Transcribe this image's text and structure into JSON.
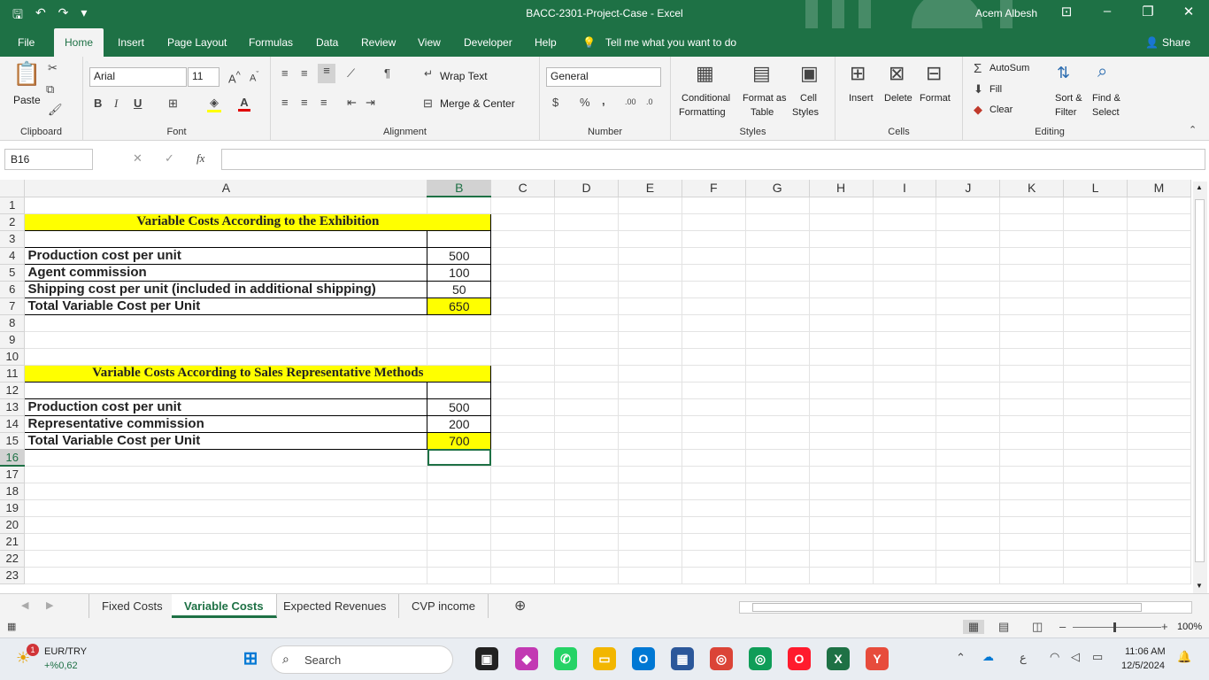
{
  "title": {
    "document": "BACC-2301-Project-Case  -  Excel",
    "user": "Acem Albesh"
  },
  "menu": {
    "tabs": [
      "File",
      "Home",
      "Insert",
      "Page Layout",
      "Formulas",
      "Data",
      "Review",
      "View",
      "Developer",
      "Help"
    ],
    "tellme": "Tell me what you want to do",
    "share": "Share"
  },
  "ribbon": {
    "clipboard": {
      "paste": "Paste",
      "label": "Clipboard"
    },
    "font": {
      "name": "Arial",
      "size": "11",
      "bold": "B",
      "italic": "I",
      "underline": "U",
      "label": "Font"
    },
    "alignment": {
      "wrap": "Wrap Text",
      "merge": "Merge & Center",
      "label": "Alignment"
    },
    "number": {
      "format": "General",
      "currency": "$",
      "percent": "%",
      "comma": ",",
      "label": "Number"
    },
    "styles": {
      "conditional1": "Conditional",
      "conditional2": "Formatting",
      "formatas1": "Format as",
      "formatas2": "Table",
      "cell1": "Cell",
      "cell2": "Styles",
      "label": "Styles"
    },
    "cells": {
      "insert": "Insert",
      "delete": "Delete",
      "format": "Format",
      "label": "Cells"
    },
    "editing": {
      "autosum": "AutoSum",
      "fill": "Fill",
      "clear": "Clear",
      "sort1": "Sort &",
      "sort2": "Filter",
      "find1": "Find &",
      "find2": "Select",
      "label": "Editing"
    }
  },
  "formula": {
    "namebox": "B16",
    "fx": "fx",
    "value": ""
  },
  "sheet": {
    "columns": [
      "A",
      "B",
      "C",
      "D",
      "E",
      "F",
      "G",
      "H",
      "I",
      "J",
      "K",
      "L",
      "M"
    ],
    "rows": [
      "1",
      "2",
      "3",
      "4",
      "5",
      "6",
      "7",
      "8",
      "9",
      "10",
      "11",
      "12",
      "13",
      "14",
      "15",
      "16",
      "17",
      "18",
      "19",
      "20",
      "21",
      "22",
      "23"
    ],
    "title1": "Variable Costs According to the Exhibition",
    "table1": [
      {
        "label": "Production cost per unit",
        "value": "500"
      },
      {
        "label": "Agent commission",
        "value": "100"
      },
      {
        "label": "Shipping cost per unit (included in additional shipping)",
        "value": "50"
      },
      {
        "label": "Total Variable Cost per Unit",
        "value": "650"
      }
    ],
    "title2": "Variable Costs According to Sales Representative Methods",
    "table2": [
      {
        "label": "Production cost per unit",
        "value": "500"
      },
      {
        "label": "Representative commission",
        "value": "200"
      },
      {
        "label": "Total Variable Cost per Unit",
        "value": "700"
      }
    ]
  },
  "tabs": [
    "Fixed Costs",
    "Variable Costs",
    "Expected Revenues",
    "CVP income"
  ],
  "status": {
    "zoom": "100%"
  },
  "taskbar": {
    "ticker": "EUR/TRY",
    "ticker_change": "+%0,62",
    "badge": "1",
    "search": "Search",
    "time": "11:06 AM",
    "date": "12/5/2024",
    "lang": "ع"
  },
  "colors": {
    "accent": "#1e7145",
    "highlight": "#ffff00"
  }
}
